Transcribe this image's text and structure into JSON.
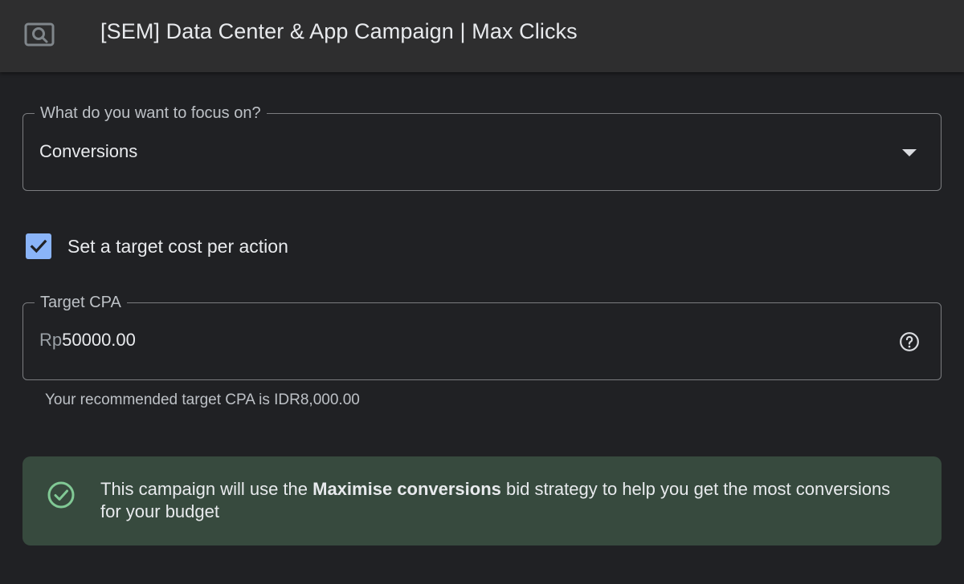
{
  "header": {
    "title": "[SEM] Data Center & App Campaign | Max Clicks",
    "icon": "search-campaign-icon"
  },
  "focus": {
    "label": "What do you want to focus on?",
    "value": "Conversions",
    "icon": "dropdown-arrow-icon"
  },
  "target_cpa_toggle": {
    "label": "Set a target cost per action",
    "checked": true,
    "icon": "checkmark-icon"
  },
  "target_cpa": {
    "label": "Target CPA",
    "prefix": "Rp",
    "value": "50000.00",
    "help_icon": "help-circle-icon",
    "hint": "Your recommended target CPA is IDR8,000.00"
  },
  "info_banner": {
    "icon": "check-circle-icon",
    "text_before": "This campaign will use the ",
    "text_bold": "Maximise conversions",
    "text_after": " bid strategy to help you get the most conversions for your budget"
  },
  "colors": {
    "background": "#202124",
    "header": "#2e2e2f",
    "checkbox": "#8ab4f8",
    "banner": "#374a3e",
    "success": "#81c995"
  }
}
